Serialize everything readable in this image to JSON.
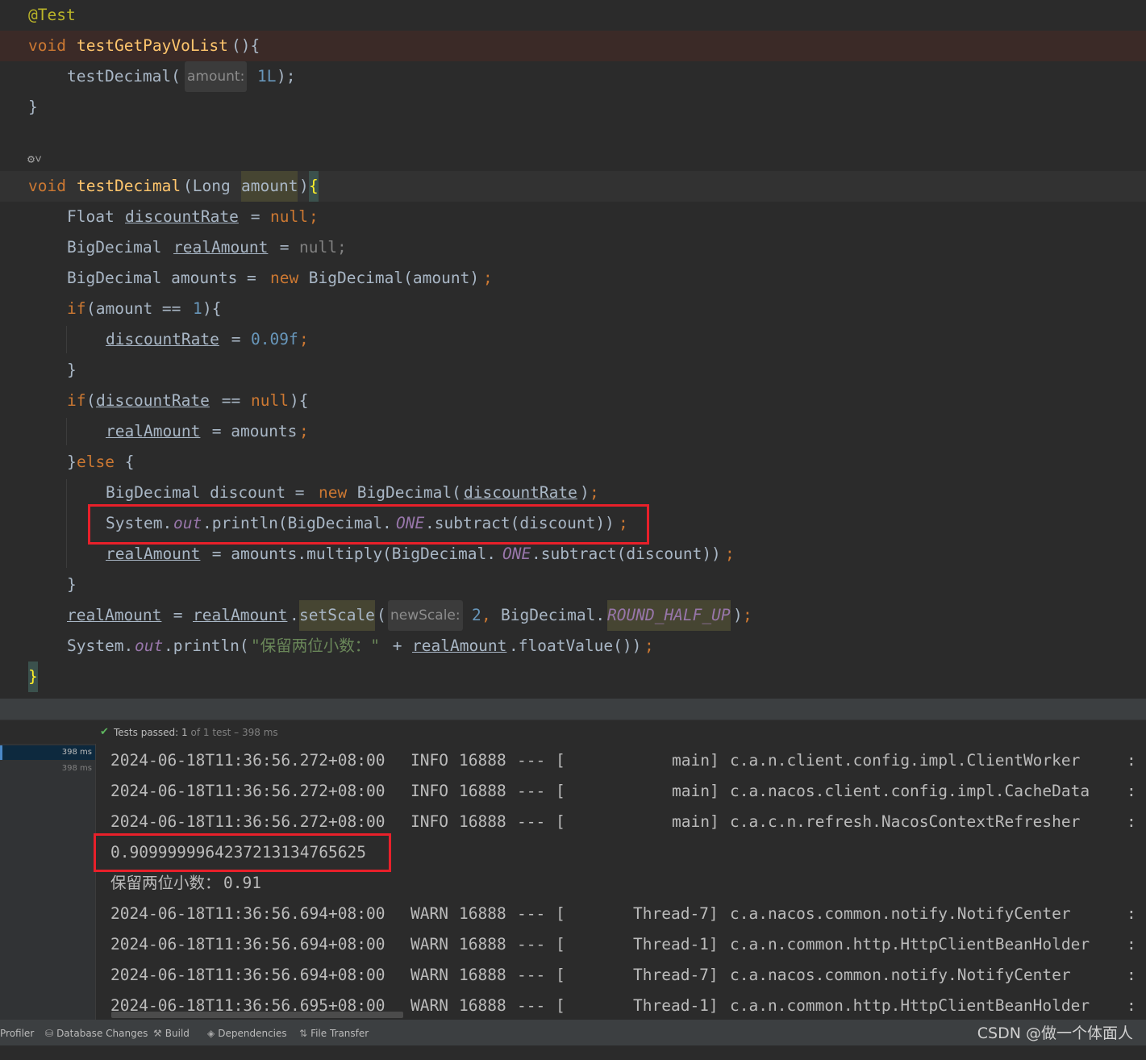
{
  "editor": {
    "annotation": "@Test",
    "m1_void": "void",
    "m1_name": "testGetPayVoList",
    "m1_paren": "(){",
    "call_name": "testDecimal(",
    "hint_amount": "amount:",
    "call_arg": "1L",
    "call_end": ");",
    "close1": "}",
    "m2_void": "void",
    "m2_name": "testDecimal",
    "m2_open": "(Long ",
    "m2_param": "amount",
    "m2_close": ")",
    "m2_brace": "{",
    "l_float_type": "Float ",
    "l_float_var": "discountRate",
    "l_float_eq": " = ",
    "l_float_null": "null",
    "l_float_semi": ";",
    "l_bd1_type": "BigDecimal ",
    "l_bd1_var": "realAmount",
    "l_bd1_rest": " = ",
    "l_bd1_null": "null;",
    "l_bd2_pre": "BigDecimal amounts = ",
    "l_bd2_new": "new",
    "l_bd2_post": " BigDecimal(amount)",
    "l_bd2_semi": ";",
    "l_if1_kw": "if",
    "l_if1_a": "(amount == ",
    "l_if1_num": "1",
    "l_if1_b": "){",
    "l_dr_var": "discountRate",
    "l_dr_eq": " = ",
    "l_dr_num": "0.09f",
    "l_dr_semi": ";",
    "l_close2": "}",
    "l_if2_kw": "if",
    "l_if2_p": "(",
    "l_if2_var": "discountRate",
    "l_if2_eq": " == ",
    "l_if2_null": "null",
    "l_if2_end": "){",
    "l_ra_var": "realAmount",
    "l_ra_rest": " = amounts",
    "l_ra_semi": ";",
    "l_else_b": "}",
    "l_else_kw": "else",
    "l_else_o": " {",
    "l_disc_pre": "BigDecimal discount = ",
    "l_disc_new": "new",
    "l_disc_mid": " BigDecimal(",
    "l_disc_var": "discountRate",
    "l_disc_end": ")",
    "l_disc_semi": ";",
    "l_sys1_a": "System.",
    "l_sys1_out": "out",
    "l_sys1_b": ".println(BigDecimal.",
    "l_sys1_one": "ONE",
    "l_sys1_c": ".subtract(discount))",
    "l_sys1_semi": ";",
    "l_mul_var": "realAmount",
    "l_mul_a": " = amounts.multiply(BigDecimal.",
    "l_mul_one": "ONE",
    "l_mul_b": ".subtract(discount))",
    "l_mul_semi": ";",
    "l_close3": "}",
    "l_ss_var": "realAmount",
    "l_ss_eq": " = ",
    "l_ss_var2": "realAmount",
    "l_ss_dot": ".",
    "l_ss_fn": "setScale",
    "l_ss_p": "(",
    "hint_newscale": "newScale:",
    "l_ss_num": "2",
    "l_ss_comma": ", ",
    "l_ss_bd": "BigDecimal.",
    "l_ss_mode": "ROUND_HALF_UP",
    "l_ss_end": ")",
    "l_ss_semi": ";",
    "l_sys2_a": "System.",
    "l_sys2_out": "out",
    "l_sys2_b": ".println(",
    "l_sys2_str": "\"保留两位小数：\"",
    "l_sys2_plus": " + ",
    "l_sys2_var": "realAmount",
    "l_sys2_c": ".floatValue())",
    "l_sys2_semi": ";",
    "close_final": "}"
  },
  "tests": {
    "status_label": "Tests passed: ",
    "passed": "1",
    "detail": " of 1 test – 398 ms"
  },
  "test_tree": {
    "time_selected": "398 ms",
    "time_other": "398 ms"
  },
  "console": {
    "log1": {
      "ts": "2024-06-18T11:36:56.272+08:00",
      "lvl": "INFO",
      "pid": "16888",
      "sep": "---",
      "br": "[",
      "thread": "main]",
      "cls": "c.a.n.client.config.impl.ClientWorker",
      "colon": ":"
    },
    "log2": {
      "ts": "2024-06-18T11:36:56.272+08:00",
      "lvl": "INFO",
      "pid": "16888",
      "sep": "---",
      "br": "[",
      "thread": "main]",
      "cls": "c.a.nacos.client.config.impl.CacheData",
      "colon": ":"
    },
    "log3": {
      "ts": "2024-06-18T11:36:56.272+08:00",
      "lvl": "INFO",
      "pid": "16888",
      "sep": "---",
      "br": "[",
      "thread": "main]",
      "cls": "c.a.c.n.refresh.NacosContextRefresher",
      "colon": ":"
    },
    "out1": "0.909999996423721313476562​5",
    "out2_label": "保留两位小数：",
    "out2_val": "0.91",
    "log4": {
      "ts": "2024-06-18T11:36:56.694+08:00",
      "lvl": "WARN",
      "pid": "16888",
      "sep": "---",
      "br": "[",
      "thread": "Thread-7]",
      "cls": "c.a.nacos.common.notify.NotifyCenter",
      "colon": ":"
    },
    "log5": {
      "ts": "2024-06-18T11:36:56.694+08:00",
      "lvl": "WARN",
      "pid": "16888",
      "sep": "---",
      "br": "[",
      "thread": "Thread-1]",
      "cls": "c.a.n.common.http.HttpClientBeanHolder",
      "colon": ":"
    },
    "log6": {
      "ts": "2024-06-18T11:36:56.694+08:00",
      "lvl": "WARN",
      "pid": "16888",
      "sep": "---",
      "br": "[",
      "thread": "Thread-7]",
      "cls": "c.a.nacos.common.notify.NotifyCenter",
      "colon": ":"
    },
    "log7": {
      "ts": "2024-06-18T11:36:56.695+08:00",
      "lvl": "WARN",
      "pid": "16888",
      "sep": "---",
      "br": "[",
      "thread": "Thread-1]",
      "cls": "c.a.n.common.http.HttpClientBeanHolder",
      "colon": ":"
    }
  },
  "statusbar": {
    "profiler": "Profiler",
    "db": "Database Changes",
    "build": "Build",
    "deps": "Dependencies",
    "ft": "File Transfer"
  },
  "watermark": "CSDN @做一个体面人"
}
